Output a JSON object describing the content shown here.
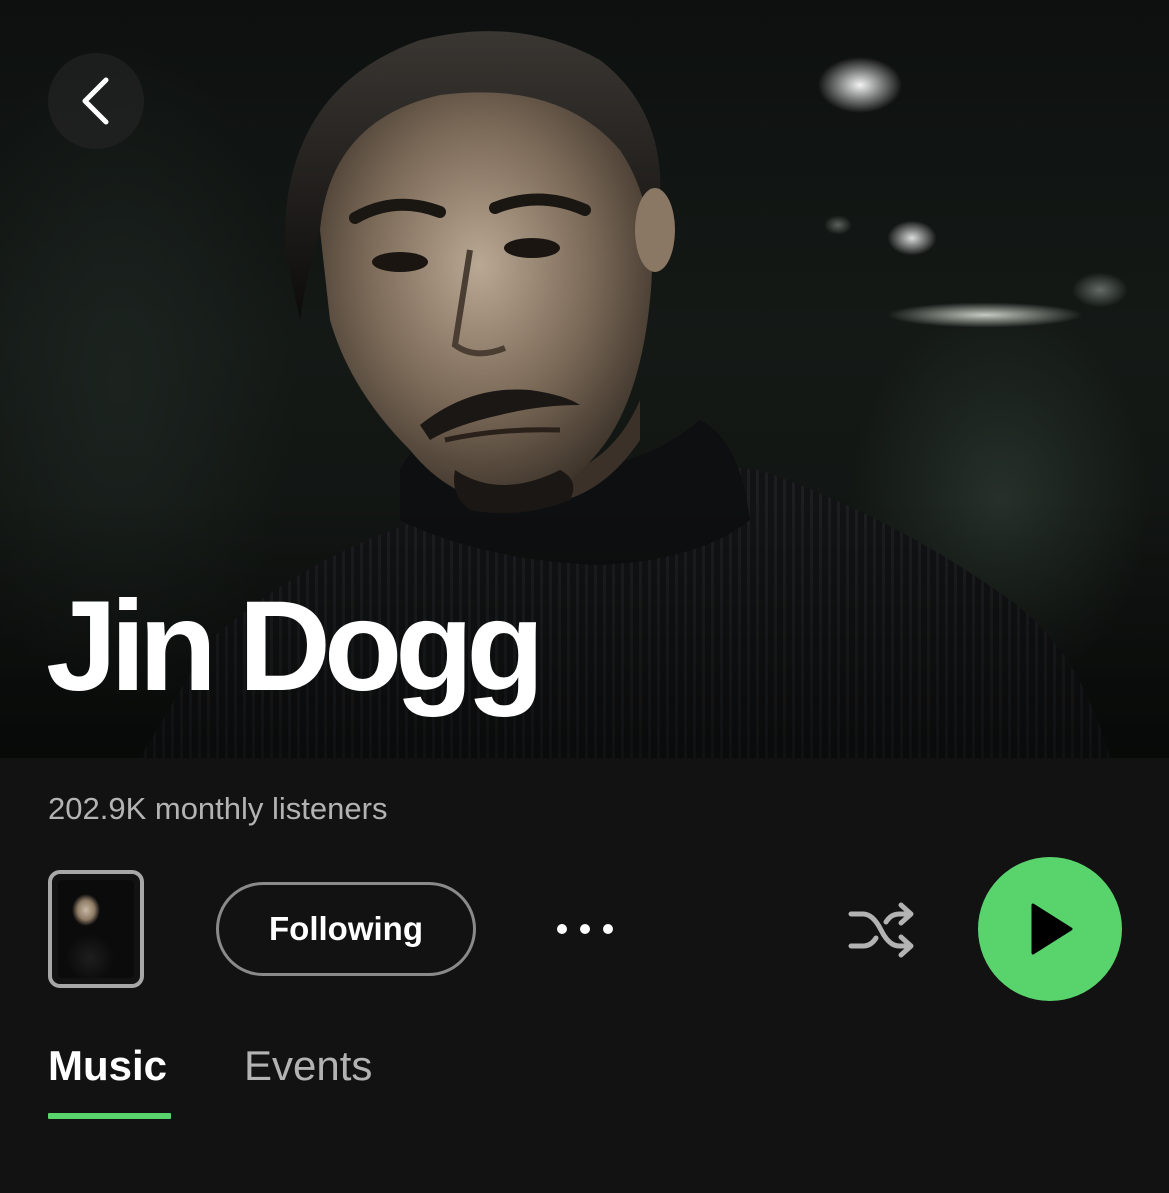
{
  "header": {
    "back_icon": "chevron-left-icon"
  },
  "artist": {
    "name": "Jin Dogg",
    "monthly_listeners": "202.9K monthly listeners"
  },
  "actions": {
    "follow_label": "Following",
    "more_icon": "more-horizontal-icon",
    "shuffle_icon": "shuffle-icon",
    "play_icon": "play-icon"
  },
  "tabs": [
    {
      "label": "Music",
      "active": true
    },
    {
      "label": "Events",
      "active": false
    }
  ],
  "colors": {
    "accent": "#59d46d",
    "background": "#121212",
    "secondary_text": "#b3b3b3"
  }
}
